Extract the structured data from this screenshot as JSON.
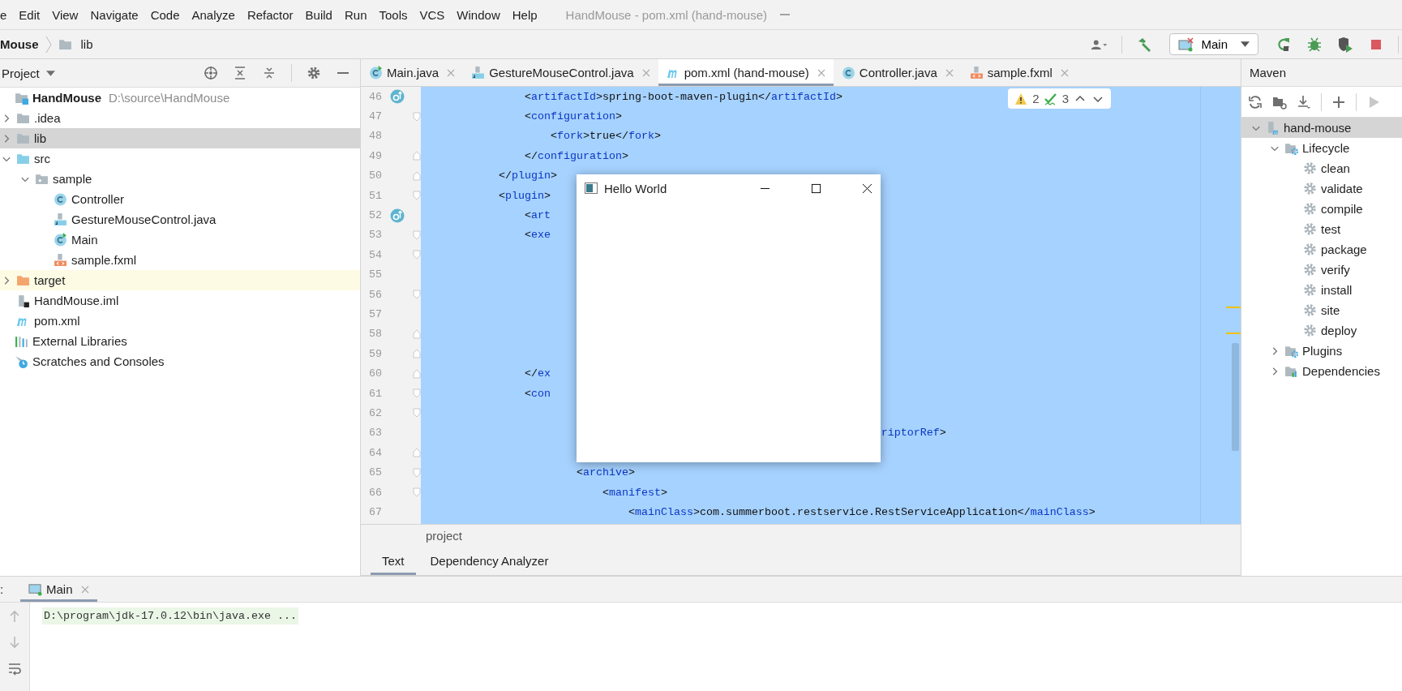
{
  "menu_bar": {
    "items": [
      "e",
      "Edit",
      "View",
      "Navigate",
      "Code",
      "Analyze",
      "Refactor",
      "Build",
      "Run",
      "Tools",
      "VCS",
      "Window",
      "Help"
    ],
    "title": "HandMouse - pom.xml (hand-mouse)"
  },
  "navigation_bar": {
    "breadcrumbs": [
      {
        "label": "Mouse",
        "kind": "module"
      },
      {
        "label": "lib",
        "kind": "folder"
      }
    ],
    "run_configuration": "Main"
  },
  "project_panel": {
    "title": "Project",
    "tree": [
      {
        "label": "HandMouse",
        "kind": "module",
        "path": "D:\\source\\HandMouse",
        "selected": false,
        "children": [
          {
            "label": ".idea",
            "kind": "folder",
            "expanded": false,
            "selected": false
          },
          {
            "label": "lib",
            "kind": "folder",
            "expanded": false,
            "selected": true
          },
          {
            "label": "src",
            "kind": "source-folder",
            "expanded": true,
            "selected": false,
            "children": [
              {
                "label": "sample",
                "kind": "package",
                "expanded": true,
                "selected": false,
                "children": [
                  {
                    "label": "Controller",
                    "kind": "class",
                    "selected": false
                  },
                  {
                    "label": "GestureMouseControl.java",
                    "kind": "java-file",
                    "selected": false
                  },
                  {
                    "label": "Main",
                    "kind": "main-class",
                    "selected": false
                  },
                  {
                    "label": "sample.fxml",
                    "kind": "fxml",
                    "selected": false
                  }
                ]
              }
            ]
          },
          {
            "label": "target",
            "kind": "excluded-folder",
            "expanded": false,
            "selected": false
          },
          {
            "label": "HandMouse.iml",
            "kind": "iml",
            "selected": false
          },
          {
            "label": "pom.xml",
            "kind": "maven",
            "selected": false
          }
        ]
      },
      {
        "label": "External Libraries",
        "kind": "libraries",
        "selected": false
      },
      {
        "label": "Scratches and Consoles",
        "kind": "scratches",
        "selected": false
      }
    ]
  },
  "editor": {
    "tabs": [
      {
        "label": "Main.java",
        "kind": "main-class",
        "selected": false
      },
      {
        "label": "GestureMouseControl.java",
        "kind": "java-file",
        "selected": false
      },
      {
        "label": "pom.xml (hand-mouse)",
        "kind": "maven",
        "selected": true
      },
      {
        "label": "Controller.java",
        "kind": "class",
        "selected": false
      },
      {
        "label": "sample.fxml",
        "kind": "fxml",
        "selected": false
      }
    ],
    "inspections": {
      "warnings": "2",
      "weak_warnings": "3"
    },
    "lines": [
      {
        "number": "46",
        "override": true,
        "fold_start": false,
        "fold_end": false,
        "text": "                <artifactId>spring-boot-maven-plugin</artifactId>"
      },
      {
        "number": "47",
        "override": false,
        "fold_start": true,
        "fold_end": false,
        "text": "                <configuration>"
      },
      {
        "number": "48",
        "override": false,
        "fold_start": false,
        "fold_end": false,
        "text": "                    <fork>true</fork>"
      },
      {
        "number": "49",
        "override": false,
        "fold_start": false,
        "fold_end": true,
        "text": "                </configuration>"
      },
      {
        "number": "50",
        "override": false,
        "fold_start": false,
        "fold_end": true,
        "text": "            </plugin>"
      },
      {
        "number": "51",
        "override": false,
        "fold_start": true,
        "fold_end": false,
        "text": "            <plugin>"
      },
      {
        "number": "52",
        "override": true,
        "fold_start": false,
        "fold_end": false,
        "text": "                <art"
      },
      {
        "number": "53",
        "override": false,
        "fold_start": true,
        "fold_end": false,
        "text": "                <exe"
      },
      {
        "number": "54",
        "override": false,
        "fold_start": true,
        "fold_end": false
      },
      {
        "number": "55",
        "override": false,
        "fold_start": false,
        "fold_end": false
      },
      {
        "number": "56",
        "override": false,
        "fold_start": true,
        "fold_end": false
      },
      {
        "number": "57",
        "override": false,
        "fold_start": false,
        "fold_end": false
      },
      {
        "number": "58",
        "override": false,
        "fold_start": false,
        "fold_end": true
      },
      {
        "number": "59",
        "override": false,
        "fold_start": false,
        "fold_end": true
      },
      {
        "number": "60",
        "override": false,
        "fold_start": false,
        "fold_end": true,
        "text": "                </ex"
      },
      {
        "number": "61",
        "override": false,
        "fold_start": true,
        "fold_end": false,
        "text": "                <con"
      },
      {
        "number": "62",
        "override": false,
        "fold_start": true,
        "fold_end": false
      },
      {
        "number": "63",
        "override": false,
        "fold_start": false,
        "fold_end": false,
        "in_tag": true,
        "text": "                                                                       riptorRef>"
      },
      {
        "number": "64",
        "override": false,
        "fold_start": false,
        "fold_end": true
      },
      {
        "number": "65",
        "override": false,
        "fold_start": true,
        "fold_end": false,
        "text": "                        <archive>"
      },
      {
        "number": "66",
        "override": false,
        "fold_start": true,
        "fold_end": false,
        "text": "                            <manifest>"
      },
      {
        "number": "67",
        "override": false,
        "fold_start": false,
        "fold_end": false,
        "text": "                                <mainClass>com.summerboot.restservice.RestServiceApplication</mainClass>"
      }
    ],
    "breadcrumb": "project",
    "bottom_tabs": [
      {
        "label": "Text",
        "selected": true
      },
      {
        "label": "Dependency Analyzer",
        "selected": false
      }
    ]
  },
  "dialog_window": {
    "title": "Hello World"
  },
  "maven_panel": {
    "title": "Maven",
    "tree": [
      {
        "label": "hand-mouse",
        "kind": "maven-project",
        "expanded": true,
        "selected": true,
        "children": [
          {
            "label": "Lifecycle",
            "kind": "lifecycle",
            "expanded": true,
            "selected": false,
            "children": [
              {
                "label": "clean",
                "kind": "goal",
                "selected": false
              },
              {
                "label": "validate",
                "kind": "goal",
                "selected": false
              },
              {
                "label": "compile",
                "kind": "goal",
                "selected": false
              },
              {
                "label": "test",
                "kind": "goal",
                "selected": false
              },
              {
                "label": "package",
                "kind": "goal",
                "selected": false
              },
              {
                "label": "verify",
                "kind": "goal",
                "selected": false
              },
              {
                "label": "install",
                "kind": "goal",
                "selected": false
              },
              {
                "label": "site",
                "kind": "goal",
                "selected": false
              },
              {
                "label": "deploy",
                "kind": "goal",
                "selected": false
              }
            ]
          },
          {
            "label": "Plugins",
            "kind": "lifecycle",
            "expanded": false,
            "selected": false
          },
          {
            "label": "Dependencies",
            "kind": "dependencies",
            "expanded": false,
            "selected": false
          }
        ]
      }
    ]
  },
  "run_panel": {
    "label": ":",
    "tabs": [
      {
        "label": "Main",
        "selected": true
      }
    ],
    "console": [
      "D:\\program\\jdk-17.0.12\\bin\\java.exe ..."
    ]
  }
}
